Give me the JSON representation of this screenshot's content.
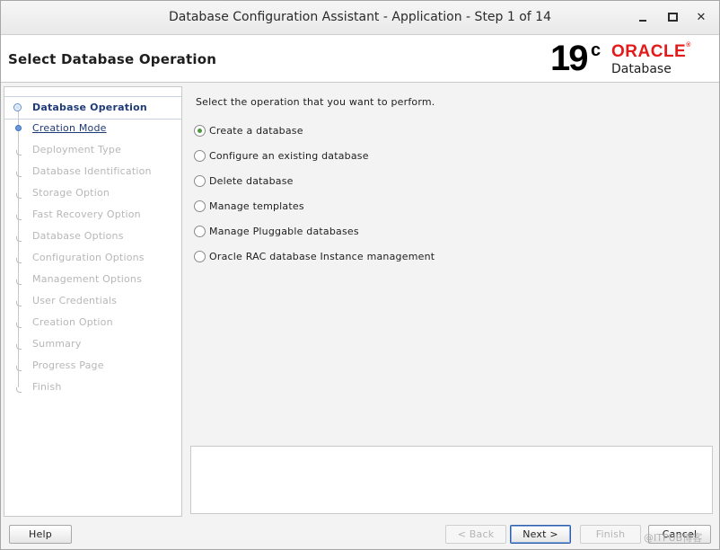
{
  "window": {
    "title": "Database Configuration Assistant - Application - Step 1 of 14"
  },
  "header": {
    "page_title": "Select Database Operation",
    "logo_version": "19",
    "logo_version_sup": "c",
    "logo_brand": "ORACLE",
    "logo_product": "Database"
  },
  "sidebar": {
    "steps": [
      {
        "label": "Database Operation",
        "state": "current"
      },
      {
        "label": "Creation Mode",
        "state": "next"
      },
      {
        "label": "Deployment Type",
        "state": "disabled"
      },
      {
        "label": "Database Identification",
        "state": "disabled"
      },
      {
        "label": "Storage Option",
        "state": "disabled"
      },
      {
        "label": "Fast Recovery Option",
        "state": "disabled"
      },
      {
        "label": "Database Options",
        "state": "disabled"
      },
      {
        "label": "Configuration Options",
        "state": "disabled"
      },
      {
        "label": "Management Options",
        "state": "disabled"
      },
      {
        "label": "User Credentials",
        "state": "disabled"
      },
      {
        "label": "Creation Option",
        "state": "disabled"
      },
      {
        "label": "Summary",
        "state": "disabled"
      },
      {
        "label": "Progress Page",
        "state": "disabled"
      },
      {
        "label": "Finish",
        "state": "disabled"
      }
    ]
  },
  "main": {
    "prompt": "Select the operation that you want to perform.",
    "options": [
      {
        "label": "Create a database",
        "checked": true
      },
      {
        "label": "Configure an existing database",
        "checked": false
      },
      {
        "label": "Delete database",
        "checked": false
      },
      {
        "label": "Manage templates",
        "checked": false
      },
      {
        "label": "Manage Pluggable databases",
        "checked": false
      },
      {
        "label": "Oracle RAC database Instance management",
        "checked": false
      }
    ]
  },
  "footer": {
    "help": "Help",
    "back": "< Back",
    "next": "Next >",
    "finish": "Finish",
    "cancel": "Cancel",
    "watermark": "@ITPUB博客"
  },
  "colors": {
    "accent": "#1f3b77",
    "oracle_red": "#e31a1a",
    "selected_radio": "#4d9a3c"
  }
}
